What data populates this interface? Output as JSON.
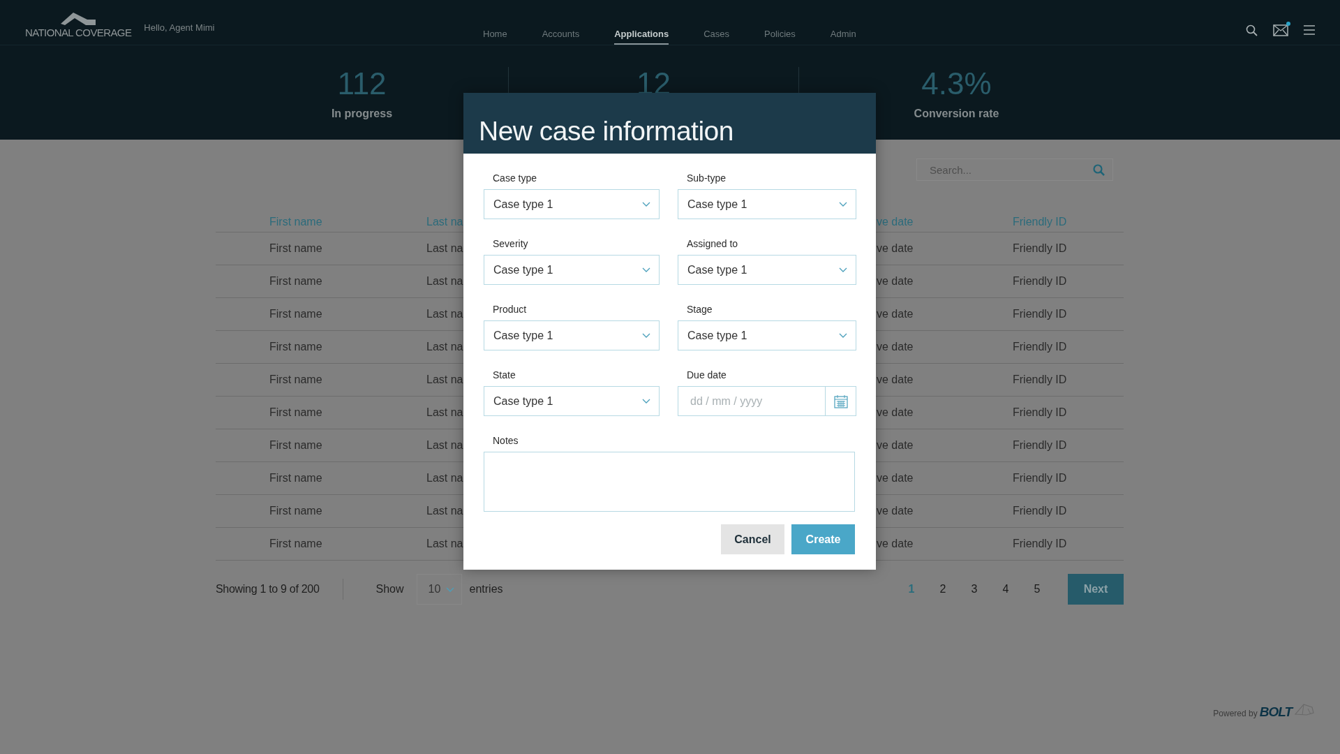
{
  "header": {
    "logo_text": "NATIONAL COVERAGE",
    "greeting": "Hello, Agent Mimi",
    "nav": [
      {
        "label": "Home",
        "selected": false
      },
      {
        "label": "Accounts",
        "selected": false
      },
      {
        "label": "Applications",
        "selected": true
      },
      {
        "label": "Cases",
        "selected": false
      },
      {
        "label": "Policies",
        "selected": false
      },
      {
        "label": "Admin",
        "selected": false
      }
    ],
    "tools": [
      {
        "kind": "search"
      },
      {
        "kind": "mail",
        "unread": true
      },
      {
        "kind": "menu"
      }
    ]
  },
  "stats": [
    {
      "value": "112",
      "label": "In progress"
    },
    {
      "value": "12"
    },
    {
      "value": "4.3%",
      "label": "Conversion rate"
    }
  ],
  "search": {
    "placeholder": "Search..."
  },
  "table": {
    "columns": [
      "First name",
      "Last na",
      "ve date",
      "Friendly ID"
    ],
    "rows": [
      [
        "First name",
        "Last na",
        "ve date",
        "Friendly ID"
      ],
      [
        "First name",
        "Last na",
        "ve date",
        "Friendly ID"
      ],
      [
        "First name",
        "Last na",
        "ve date",
        "Friendly ID"
      ],
      [
        "First name",
        "Last na",
        "ve date",
        "Friendly ID"
      ],
      [
        "First name",
        "Last na",
        "ve date",
        "Friendly ID"
      ],
      [
        "First name",
        "Last na",
        "ve date",
        "Friendly ID"
      ],
      [
        "First name",
        "Last na",
        "ve date",
        "Friendly ID"
      ],
      [
        "First name",
        "Last na",
        "ve date",
        "Friendly ID"
      ],
      [
        "First name",
        "Last na",
        "ve date",
        "Friendly ID"
      ],
      [
        "First name",
        "Last na",
        "ve date",
        "Friendly ID"
      ]
    ]
  },
  "footer": {
    "summary": "Showing 1 to 9 of 200",
    "show_label": "Show",
    "page_size": "10",
    "entries_label": "entries",
    "pages": [
      {
        "label": "1",
        "selected": true
      },
      {
        "label": "2",
        "selected": false
      },
      {
        "label": "3",
        "selected": false
      },
      {
        "label": "4",
        "selected": false
      },
      {
        "label": "5",
        "selected": false
      }
    ],
    "next": "Next"
  },
  "powered_by": {
    "text": "Powered by",
    "brand": "BOLT"
  },
  "modal": {
    "title": "New case information",
    "fields": [
      {
        "label": "Case type",
        "kind": "select",
        "value": "Case type 1"
      },
      {
        "label": "Sub-type",
        "kind": "select",
        "value": "Case type 1"
      },
      {
        "label": "Severity",
        "kind": "select",
        "value": "Case type 1"
      },
      {
        "label": "Assigned to",
        "kind": "select",
        "value": "Case type 1"
      },
      {
        "label": "Product",
        "kind": "select",
        "value": "Case type 1"
      },
      {
        "label": "Stage",
        "kind": "select",
        "value": "Case type 1"
      },
      {
        "label": "State",
        "kind": "select",
        "value": "Case type 1"
      },
      {
        "label": "Due date",
        "kind": "date",
        "placeholder": "dd / mm / yyyy"
      }
    ],
    "notes": {
      "label": "Notes"
    },
    "buttons": [
      {
        "label": "Cancel",
        "kind": "secondary"
      },
      {
        "label": "Create",
        "kind": "primary"
      }
    ]
  }
}
